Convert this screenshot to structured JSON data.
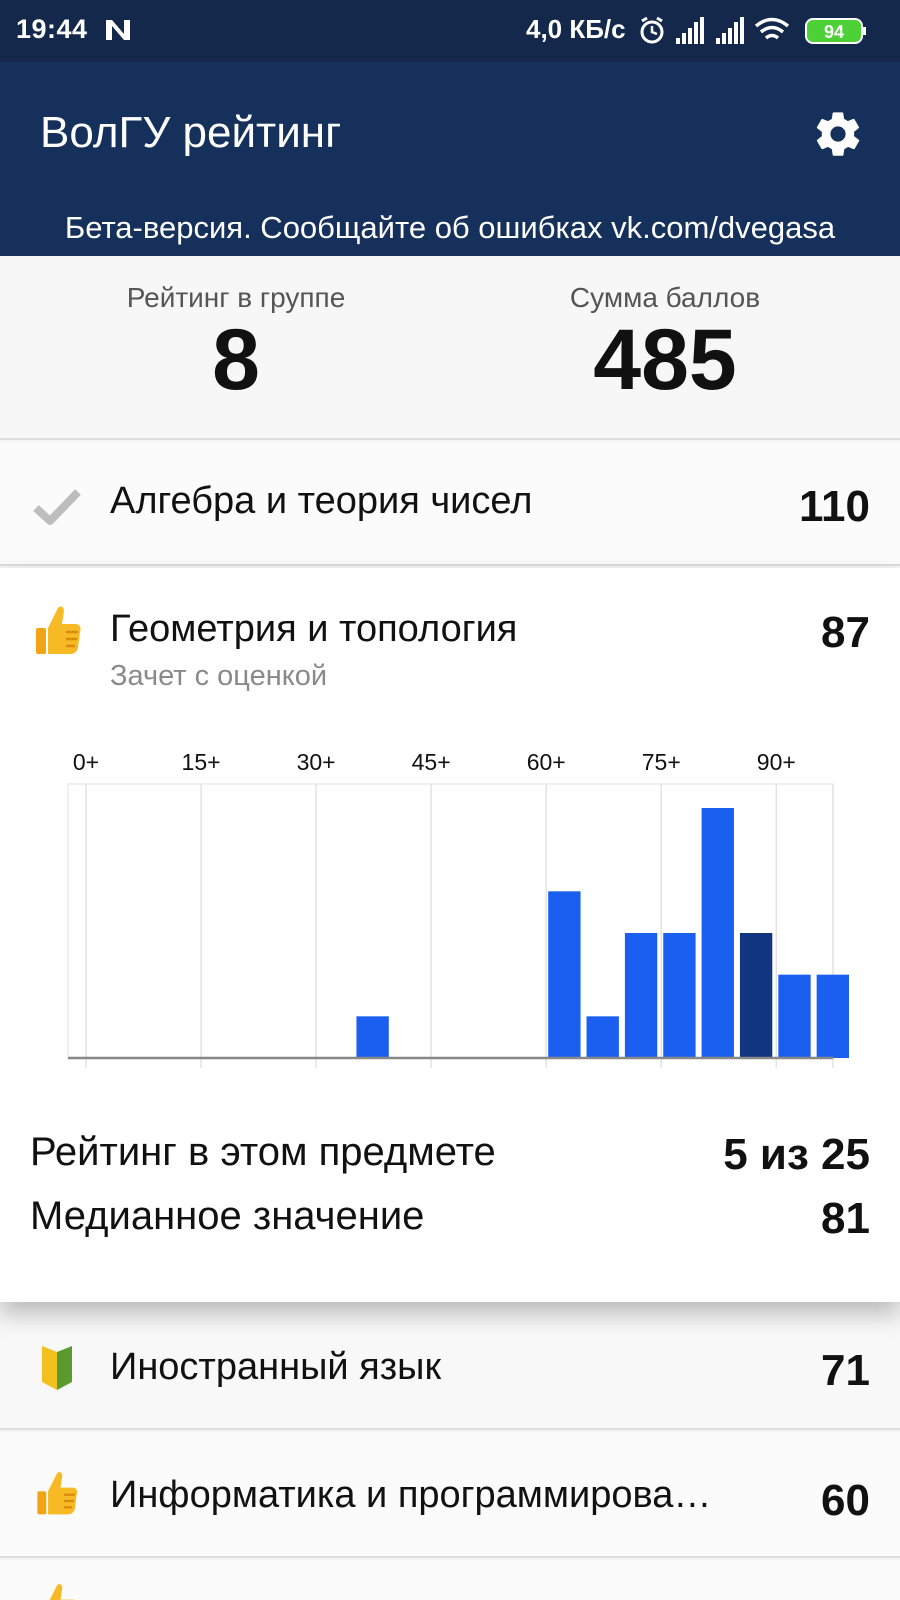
{
  "status_bar": {
    "time": "19:44",
    "network_speed": "4,0 КБ/с",
    "battery": "94",
    "icons": [
      "n-app-icon",
      "alarm-icon",
      "signal-icon",
      "signal-icon",
      "wifi-icon",
      "battery-icon"
    ]
  },
  "app_bar": {
    "title": "ВолГУ рейтинг",
    "beta_notice": "Бета-версия. Сообщайте об ошибках vk.com/dvegasa",
    "settings_icon": "gear-icon"
  },
  "summary": {
    "group_rating_label": "Рейтинг в группе",
    "group_rating_value": "8",
    "total_points_label": "Сумма баллов",
    "total_points_value": "485"
  },
  "subjects": [
    {
      "name": "Алгебра и теория чисел",
      "score": "110",
      "icon": "check-icon"
    },
    {
      "name": "Геометрия и топология",
      "score": "87",
      "icon": "thumbs-up-icon",
      "subtitle": "Зачет с оценкой"
    },
    {
      "name": "Иностранный язык",
      "score": "71",
      "icon": "beginner-badge-icon"
    },
    {
      "name": "Информатика и программирова…",
      "score": "60",
      "icon": "thumbs-up-icon"
    },
    {
      "name": "",
      "score": "",
      "icon": "thumbs-up-icon"
    }
  ],
  "details": {
    "rating_label": "Рейтинг в этом предмете",
    "rating_value": "5 из 25",
    "median_label": "Медианное значение",
    "median_value": "81"
  },
  "colors": {
    "status_bar": "#13284a",
    "app_bar": "#15305a",
    "bar": "#1a5ff0",
    "bar_highlight": "#11357e"
  },
  "chart_data": {
    "type": "bar",
    "tick_labels": [
      "0+",
      "15+",
      "30+",
      "45+",
      "60+",
      "75+",
      "90+"
    ],
    "bin_width": 5,
    "bins_start": [
      35,
      60,
      65,
      70,
      75,
      80,
      85,
      90,
      95
    ],
    "values": [
      1,
      4,
      1,
      3,
      3,
      6,
      3,
      2,
      2
    ],
    "highlight_bin_start": 85,
    "ylim": [
      0,
      6.1
    ]
  }
}
